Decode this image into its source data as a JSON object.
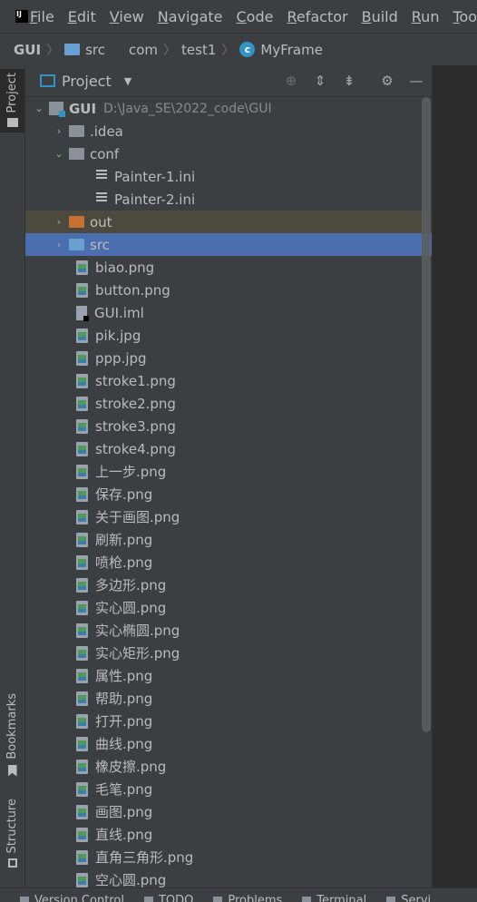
{
  "menubar": {
    "items": [
      {
        "u": "F",
        "rest": "ile"
      },
      {
        "u": "E",
        "rest": "dit"
      },
      {
        "u": "V",
        "rest": "iew"
      },
      {
        "u": "N",
        "rest": "avigate"
      },
      {
        "u": "C",
        "rest": "ode"
      },
      {
        "u": "R",
        "rest": "efactor"
      },
      {
        "u": "B",
        "rest": "uild"
      },
      {
        "u": "R",
        "rest": "un"
      },
      {
        "u": "T",
        "rest": "ools"
      }
    ]
  },
  "breadcrumb": {
    "project": "GUI",
    "src": "src",
    "pkg1": "com",
    "pkg2": "test1",
    "cls": "MyFrame"
  },
  "toolwindow": {
    "title": "Project"
  },
  "sidebar": {
    "project_tab": "Project",
    "bookmarks_tab": "Bookmarks",
    "structure_tab": "Structure"
  },
  "tree": {
    "root": {
      "name": "GUI",
      "path": "D:\\Java_SE\\2022_code\\GUI"
    },
    "idea": ".idea",
    "conf": "conf",
    "ini_files": [
      "Painter-1.ini",
      "Painter-2.ini"
    ],
    "out": "out",
    "src": "src",
    "files": [
      "biao.png",
      "button.png",
      "GUI.iml",
      "pik.jpg",
      "ppp.jpg",
      "stroke1.png",
      "stroke2.png",
      "stroke3.png",
      "stroke4.png",
      "上一步.png",
      "保存.png",
      "关于画图.png",
      "刷新.png",
      "喷枪.png",
      "多边形.png",
      "实心圆.png",
      "实心椭圆.png",
      "实心矩形.png",
      "属性.png",
      "帮助.png",
      "打开.png",
      "曲线.png",
      "橡皮擦.png",
      "毛笔.png",
      "画图.png",
      "直线.png",
      "直角三角形.png",
      "空心圆.png"
    ]
  },
  "statusbar": {
    "items": [
      "Version Control",
      "TODO",
      "Problems",
      "Terminal",
      "Servi"
    ]
  }
}
